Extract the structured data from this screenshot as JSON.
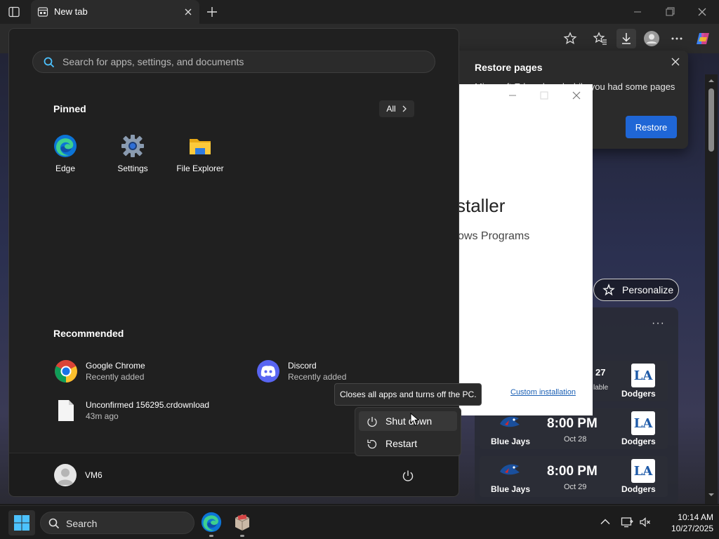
{
  "browser": {
    "tab_title": "New tab",
    "restore_popup": {
      "title": "Restore pages",
      "text": "Microsoft Edge closed while you had some pages",
      "button": "Restore"
    }
  },
  "installer": {
    "title_fragment": "staller",
    "subtitle_fragment": "ows Programs",
    "link": "Custom installation"
  },
  "page": {
    "personalize_label": "Personalize",
    "more_glyph": "···",
    "games": [
      {
        "away": "",
        "time": "27",
        "date": "lable",
        "home": "Dodgers"
      },
      {
        "away": "Blue Jays",
        "time": "8:00 PM",
        "date": "Oct 28",
        "home": "Dodgers"
      },
      {
        "away": "Blue Jays",
        "time": "8:00 PM",
        "date": "Oct 29",
        "home": "Dodgers"
      }
    ],
    "dodgers_logo_text": "LA"
  },
  "start_menu": {
    "search_placeholder": "Search for apps, settings, and documents",
    "pinned_title": "Pinned",
    "all_button": "All",
    "pinned": [
      {
        "label": "Edge",
        "icon": "edge-icon"
      },
      {
        "label": "Settings",
        "icon": "settings-gear-icon"
      },
      {
        "label": "File Explorer",
        "icon": "folder-icon"
      }
    ],
    "recommended_title": "Recommended",
    "recommended": [
      {
        "name": "Google Chrome",
        "sub": "Recently added",
        "icon": "chrome-icon"
      },
      {
        "name": "Discord",
        "sub": "Recently added",
        "icon": "discord-icon"
      },
      {
        "name": "Unconfirmed 156295.crdownload",
        "sub": "43m ago",
        "icon": "file-icon"
      }
    ],
    "user_name": "VM6",
    "power_tooltip": "Closes all apps and turns off the PC.",
    "power_menu": [
      {
        "label": "Shut down",
        "icon": "power-icon"
      },
      {
        "label": "Restart",
        "icon": "restart-icon"
      }
    ]
  },
  "taskbar": {
    "search_label": "Search",
    "time": "10:14 AM",
    "date": "10/27/2025"
  },
  "colors": {
    "accent_blue": "#1f66d6",
    "taskbar_bg": "#1c1c1c",
    "start_bg": "#202020"
  }
}
